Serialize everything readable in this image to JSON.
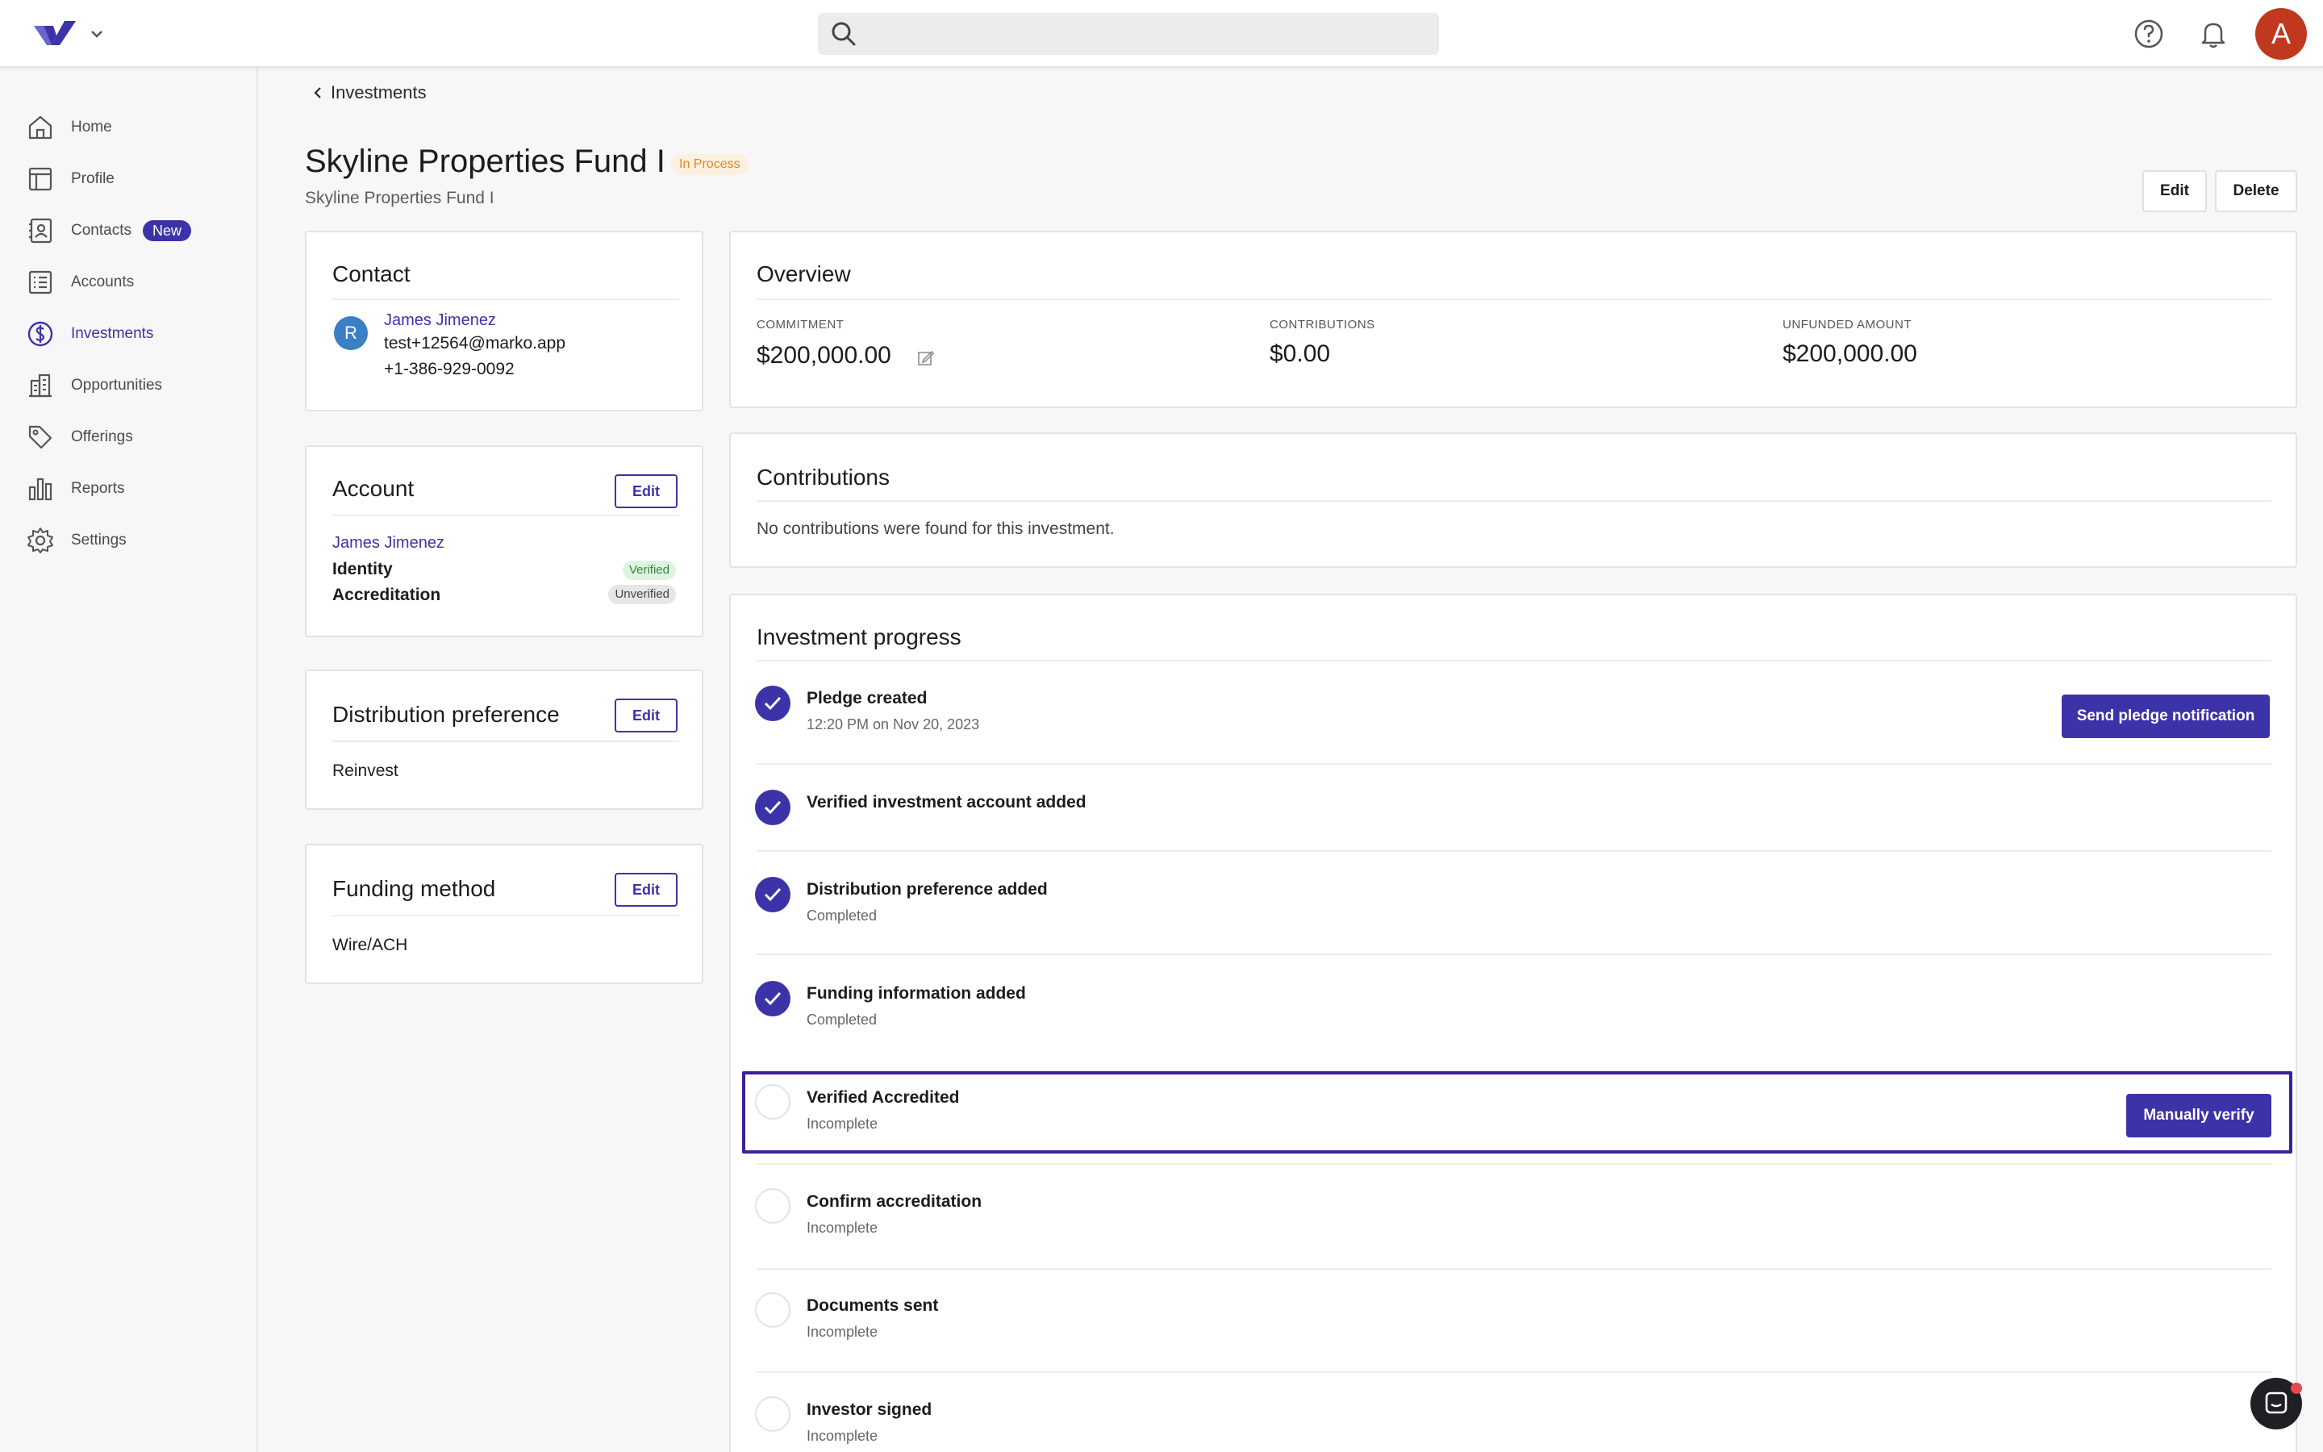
{
  "topbar": {
    "search_placeholder": "",
    "avatar_initial": "A",
    "icons": [
      "logo-icon",
      "chevron-down-icon",
      "search-icon",
      "help-icon",
      "bell-icon"
    ]
  },
  "sidebar": {
    "items": [
      {
        "label": "Home",
        "icon": "home-icon"
      },
      {
        "label": "Profile",
        "icon": "profile-icon"
      },
      {
        "label": "Contacts",
        "icon": "contacts-icon",
        "badge": "New"
      },
      {
        "label": "Accounts",
        "icon": "accounts-icon"
      },
      {
        "label": "Investments",
        "icon": "dollar-icon",
        "active": true
      },
      {
        "label": "Opportunities",
        "icon": "building-icon"
      },
      {
        "label": "Offerings",
        "icon": "tag-icon"
      },
      {
        "label": "Reports",
        "icon": "bar-chart-icon"
      },
      {
        "label": "Settings",
        "icon": "gear-icon"
      }
    ]
  },
  "header": {
    "back_label": "Investments",
    "title": "Skyline Properties Fund I",
    "status": "In Process",
    "subtitle": "Skyline Properties Fund I",
    "edit_label": "Edit",
    "delete_label": "Delete"
  },
  "contact": {
    "title": "Contact",
    "avatar_initial": "R",
    "name": "James Jimenez",
    "email": "test+12564@marko.app",
    "phone": "+1-386-929-0092"
  },
  "account": {
    "title": "Account",
    "edit_label": "Edit",
    "name": "James Jimenez",
    "identity_label": "Identity",
    "identity_status": "Verified",
    "accreditation_label": "Accreditation",
    "accreditation_status": "Unverified"
  },
  "distribution": {
    "title": "Distribution preference",
    "edit_label": "Edit",
    "value": "Reinvest"
  },
  "funding": {
    "title": "Funding method",
    "edit_label": "Edit",
    "value": "Wire/ACH"
  },
  "overview": {
    "title": "Overview",
    "commitment_label": "COMMITMENT",
    "commitment_value": "$200,000.00",
    "contributions_label": "CONTRIBUTIONS",
    "contributions_value": "$0.00",
    "unfunded_label": "UNFUNDED AMOUNT",
    "unfunded_value": "$200,000.00"
  },
  "contributions": {
    "title": "Contributions",
    "empty_message": "No contributions were found for this investment."
  },
  "progress": {
    "title": "Investment progress",
    "steps": [
      {
        "title": "Pledge created",
        "sub": "12:20 PM on Nov 20, 2023",
        "done": true,
        "action": "Send pledge notification"
      },
      {
        "title": "Verified investment account added",
        "sub": "",
        "done": true
      },
      {
        "title": "Distribution preference added",
        "sub": "Completed",
        "done": true
      },
      {
        "title": "Funding information added",
        "sub": "Completed",
        "done": true
      },
      {
        "title": "Verified Accredited",
        "sub": "Incomplete",
        "done": false,
        "action": "Manually verify"
      },
      {
        "title": "Confirm accreditation",
        "sub": "Incomplete",
        "done": false
      },
      {
        "title": "Documents sent",
        "sub": "Incomplete",
        "done": false
      },
      {
        "title": "Investor signed",
        "sub": "Incomplete",
        "done": false
      }
    ]
  },
  "colors": {
    "accent": "#3d33a8",
    "status_in_process": "#e08a1e",
    "verified": "#2f8a3f",
    "avatar": "#c0391f"
  }
}
